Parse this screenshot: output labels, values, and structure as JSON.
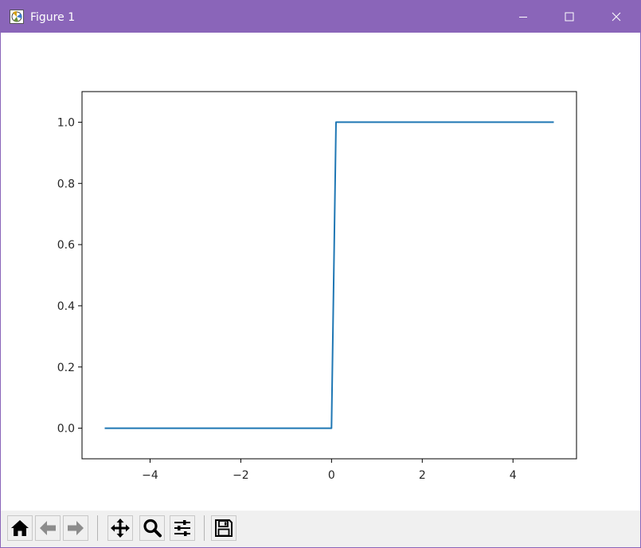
{
  "window": {
    "title": "Figure 1",
    "titlebar_color": "#8a65b9",
    "controls": [
      "minimize-icon",
      "maximize-icon",
      "close-icon"
    ]
  },
  "chart_data": {
    "type": "line",
    "title": "",
    "xlabel": "",
    "ylabel": "",
    "xlim": [
      -5.5,
      5.4
    ],
    "ylim": [
      -0.1,
      1.1
    ],
    "grid": false,
    "line_color": "#1f77b4",
    "x_ticks": [
      -4,
      -2,
      0,
      2,
      4
    ],
    "x_tick_labels": [
      "−4",
      "−2",
      "0",
      "2",
      "4"
    ],
    "y_ticks": [
      0.0,
      0.2,
      0.4,
      0.6,
      0.8,
      1.0
    ],
    "y_tick_labels": [
      "0.0",
      "0.2",
      "0.4",
      "0.6",
      "0.8",
      "1.0"
    ],
    "series": [
      {
        "x": [
          -5.0,
          0.0,
          0.1,
          4.9
        ],
        "y": [
          0,
          0,
          1,
          1
        ]
      }
    ]
  },
  "toolbar": {
    "buttons": [
      {
        "icon": "home-icon"
      },
      {
        "icon": "back-arrow-icon"
      },
      {
        "icon": "forward-arrow-icon"
      },
      {
        "icon": "pan-icon"
      },
      {
        "icon": "zoom-icon"
      },
      {
        "icon": "configure-subplots-icon"
      },
      {
        "icon": "save-icon"
      }
    ]
  }
}
